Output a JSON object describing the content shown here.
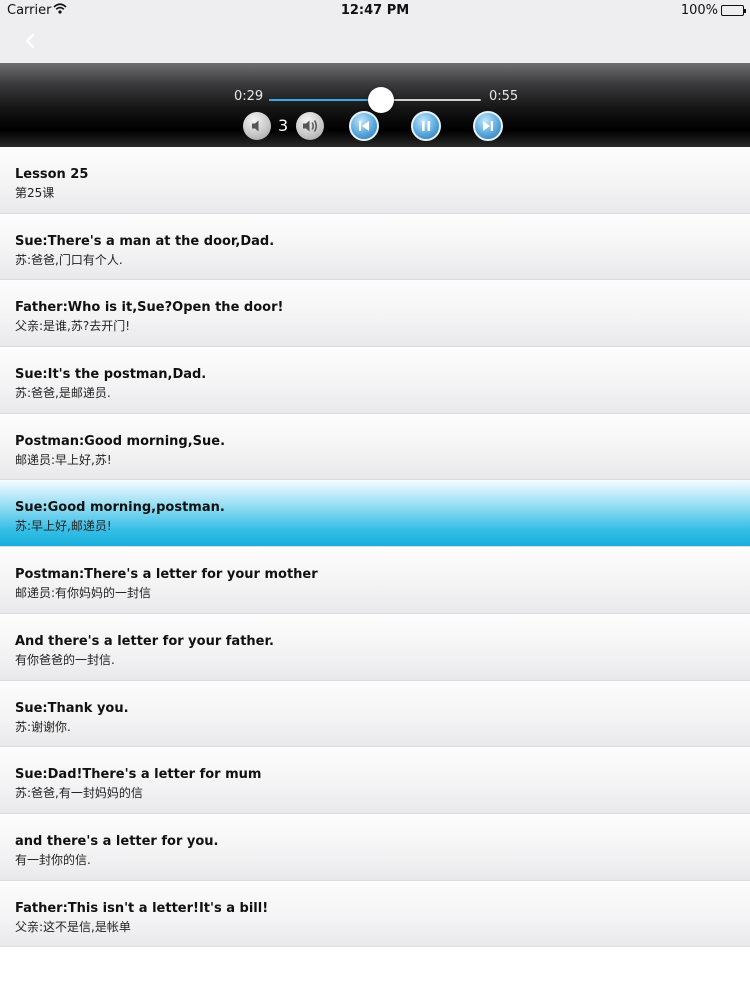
{
  "status_bar": {
    "carrier": "Carrier",
    "time": "12:47 PM",
    "battery": "100%"
  },
  "player": {
    "current_time": "0:29",
    "total_time": "0:55",
    "progress_fraction": 0.527,
    "volume_level": "3",
    "accent_color": "#3ba7e3"
  },
  "lessons": [
    {
      "en": "Lesson 25",
      "cn": "第25课"
    },
    {
      "en": "Sue:There's a man at the door,Dad.",
      "cn": "苏:爸爸,门口有个人."
    },
    {
      "en": "Father:Who is it,Sue?Open the door!",
      "cn": "父亲:是谁,苏?去开门!"
    },
    {
      "en": "Sue:It's the postman,Dad.",
      "cn": "苏:爸爸,是邮递员."
    },
    {
      "en": "Postman:Good morning,Sue.",
      "cn": "邮递员:早上好,苏!"
    },
    {
      "en": "Sue:Good morning,postman.",
      "cn": "苏:早上好,邮递员!"
    },
    {
      "en": "Postman:There's a letter for your mother",
      "cn": "邮递员:有你妈妈的一封信"
    },
    {
      "en": "And there's a letter for your father.",
      "cn": "有你爸爸的一封信."
    },
    {
      "en": "Sue:Thank you.",
      "cn": "苏:谢谢你."
    },
    {
      "en": "Sue:Dad!There's a letter for mum",
      "cn": "苏:爸爸,有一封妈妈的信"
    },
    {
      "en": "and there's a letter for you.",
      "cn": "有一封你的信."
    },
    {
      "en": "Father:This isn't a letter!It's a bill!",
      "cn": "父亲:这不是信,是帐单"
    }
  ],
  "selected_index": 5,
  "selected_color": "#17aedc"
}
